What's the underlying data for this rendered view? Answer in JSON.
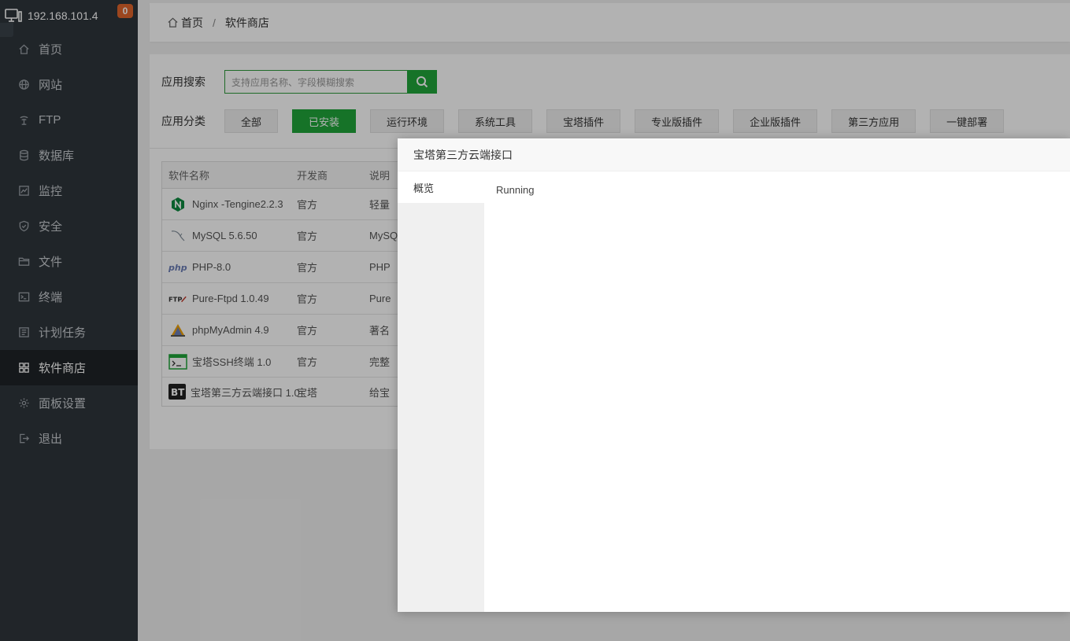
{
  "header": {
    "ip": "192.168.101.4",
    "badge": "0"
  },
  "menu": [
    {
      "label": "首页",
      "icon": "home-icon"
    },
    {
      "label": "网站",
      "icon": "globe-icon"
    },
    {
      "label": "FTP",
      "icon": "ftp-icon"
    },
    {
      "label": "数据库",
      "icon": "database-icon"
    },
    {
      "label": "监控",
      "icon": "monitor-icon"
    },
    {
      "label": "安全",
      "icon": "shield-icon"
    },
    {
      "label": "文件",
      "icon": "folder-icon"
    },
    {
      "label": "终端",
      "icon": "terminal-icon"
    },
    {
      "label": "计划任务",
      "icon": "calendar-icon"
    },
    {
      "label": "软件商店",
      "icon": "grid-icon",
      "active": true
    },
    {
      "label": "面板设置",
      "icon": "gear-icon"
    },
    {
      "label": "退出",
      "icon": "logout-icon"
    }
  ],
  "breadcrumb": {
    "home": "首页",
    "sep": "/",
    "current": "软件商店"
  },
  "search": {
    "label": "应用搜索",
    "placeholder": "支持应用名称、字段模糊搜索"
  },
  "categories": {
    "label": "应用分类",
    "items": [
      "全部",
      "已安装",
      "运行环境",
      "系统工具",
      "宝塔插件",
      "专业版插件",
      "企业版插件",
      "第三方应用",
      "一键部署"
    ],
    "selected": "已安装"
  },
  "table": {
    "headers": [
      "软件名称",
      "开发商",
      "说明"
    ],
    "rows": [
      {
        "name": "Nginx -Tengine2.2.3",
        "vendor": "官方",
        "desc": "轻量",
        "logo": "nginx-icon"
      },
      {
        "name": "MySQL 5.6.50",
        "vendor": "官方",
        "desc": "MySQ",
        "logo": "mysql-icon"
      },
      {
        "name": "PHP-8.0",
        "vendor": "官方",
        "desc": "PHP",
        "logo": "php-icon"
      },
      {
        "name": "Pure-Ftpd 1.0.49",
        "vendor": "官方",
        "desc": "Pure",
        "logo": "ftp-logo-icon"
      },
      {
        "name": "phpMyAdmin 4.9",
        "vendor": "官方",
        "desc": "著名",
        "logo": "phpmyadmin-icon"
      },
      {
        "name": "宝塔SSH终端 1.0",
        "vendor": "官方",
        "desc": "完整",
        "logo": "ssh-terminal-icon"
      },
      {
        "name": "宝塔第三方云端接口 1.0",
        "vendor": "宝塔",
        "desc": "给宝",
        "logo": "bt-icon"
      }
    ]
  },
  "modal": {
    "title": "宝塔第三方云端接口",
    "tab": "概览",
    "status": "Running"
  },
  "colors": {
    "accent": "#20a53a",
    "sidebar": "#2f353b",
    "badge": "#e0652b"
  }
}
